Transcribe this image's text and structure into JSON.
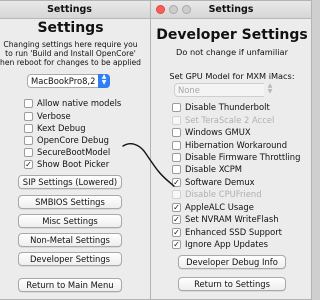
{
  "left_window": {
    "title": "Settings",
    "heading": "Settings",
    "info_lines": [
      "Changing settings here require you",
      "to run 'Build and Install OpenCore'",
      "hen reboot for changes to be applied"
    ],
    "model_select": {
      "value": "MacBookPro8,2"
    },
    "checkboxes": [
      {
        "label": "Allow native models",
        "checked": false
      },
      {
        "label": "Verbose",
        "checked": false
      },
      {
        "label": "Kext Debug",
        "checked": false
      },
      {
        "label": "OpenCore Debug",
        "checked": false
      },
      {
        "label": "SecureBootModel",
        "checked": false
      },
      {
        "label": "Show Boot Picker",
        "checked": true
      }
    ],
    "buttons": [
      "SIP Settings (Lowered)",
      "SMBIOS Settings",
      "Misc Settings",
      "Non-Metal Settings",
      "Developer Settings",
      "Return to Main Menu"
    ]
  },
  "right_window": {
    "title": "Settings",
    "heading": "Developer Settings",
    "warning": "Do not change if unfamiliar",
    "gpu_label": "Set GPU Model for MXM iMacs:",
    "gpu_select": {
      "value": "None"
    },
    "checkboxes": [
      {
        "label": "Disable Thunderbolt",
        "checked": false,
        "enabled": true
      },
      {
        "label": "Set TeraScale 2 Accel",
        "checked": false,
        "enabled": false
      },
      {
        "label": "Windows GMUX",
        "checked": false,
        "enabled": true
      },
      {
        "label": "Hibernation Workaround",
        "checked": false,
        "enabled": true
      },
      {
        "label": "Disable Firmware Throttling",
        "checked": false,
        "enabled": true
      },
      {
        "label": "Disable XCPM",
        "checked": false,
        "enabled": true
      },
      {
        "label": "Software Demux",
        "checked": true,
        "enabled": true
      },
      {
        "label": "Disable CPUFriend",
        "checked": false,
        "enabled": false
      },
      {
        "label": "AppleALC Usage",
        "checked": true,
        "enabled": true
      },
      {
        "label": "Set NVRAM WriteFlash",
        "checked": true,
        "enabled": true
      },
      {
        "label": "Enhanced SSD Support",
        "checked": true,
        "enabled": true
      },
      {
        "label": "Ignore App Updates",
        "checked": true,
        "enabled": true
      }
    ],
    "buttons": [
      "Developer Debug Info",
      "Return to Settings"
    ]
  },
  "colors": {
    "window_bg": "#ececec",
    "accent": "#2f7ef5",
    "close_button": "#fc5f57",
    "annotation_ink": "#111111"
  }
}
